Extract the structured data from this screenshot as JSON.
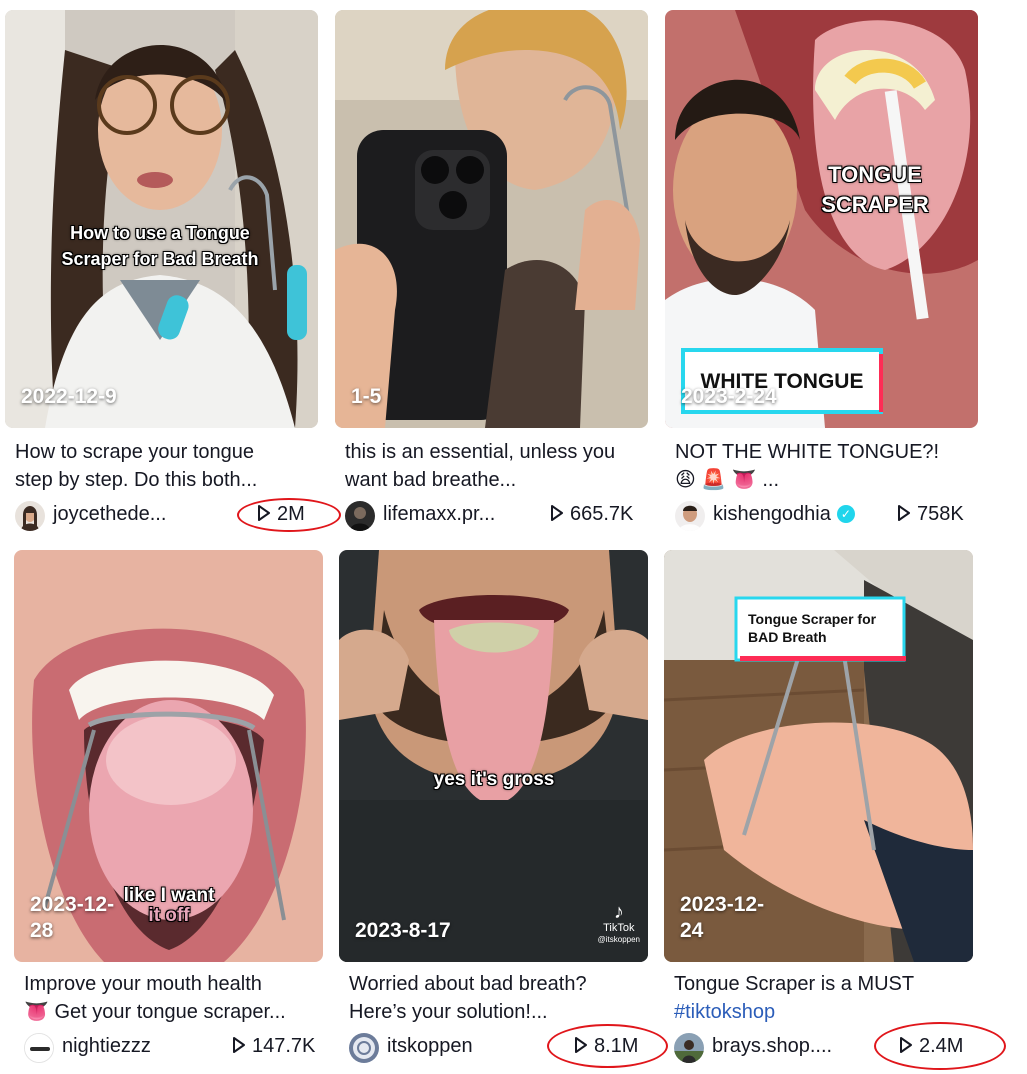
{
  "videos": [
    {
      "date": "2022-12-9",
      "overlay": "How to use a Tongue Scraper for Bad Breath",
      "desc_line1": "How to scrape your tongue",
      "desc_line2": "step by step. Do this both...",
      "author": "joycethede...",
      "views": "2M",
      "highlighted": true
    },
    {
      "date": "1-5",
      "overlay": "",
      "desc_line1": "this is an essential, unless you",
      "desc_line2": "want bad breathe...",
      "author": "lifemaxx.pr...",
      "views": "665.7K",
      "highlighted": false
    },
    {
      "date": "2023-2-24",
      "overlay": "TONGUE SCRAPER",
      "overlay2": "WHITE TONGUE",
      "desc_line1": "NOT THE WHITE TONGUE?!",
      "desc_line2": "😩 🚨 👅 ...",
      "author": "kishengodhia",
      "verified": true,
      "views": "758K",
      "highlighted": false
    },
    {
      "date": "2023-12-28",
      "overlay": "like I want",
      "overlay2": "it off",
      "desc_line1": "Improve your mouth health",
      "desc_line2": "👅 Get your tongue scraper...",
      "author": "nightiezzz",
      "views": "147.7K",
      "highlighted": false
    },
    {
      "date": "2023-8-17",
      "overlay": "yes it's gross",
      "watermark": "TikTok",
      "watermark_user": "@itskoppen",
      "desc_line1": "Worried about bad breath?",
      "desc_line2": "Here’s your solution!...",
      "author": "itskoppen",
      "views": "8.1M",
      "highlighted": true
    },
    {
      "date": "2023-12-24",
      "overlay": "Tongue Scraper for BAD Breath",
      "desc_line1": "Tongue Scraper is a MUST",
      "desc_line2": "#tiktokshop",
      "author": "brays.shop....",
      "views": "2.4M",
      "highlighted": true
    }
  ],
  "colors": {
    "highlight": "#e0161b",
    "hashtag": "#2b5db9",
    "verified": "#20d5ec",
    "text": "#161823"
  },
  "icons": {
    "views": "play-icon",
    "verified": "verified-check-icon",
    "watermark": "tiktok-logo-icon"
  }
}
